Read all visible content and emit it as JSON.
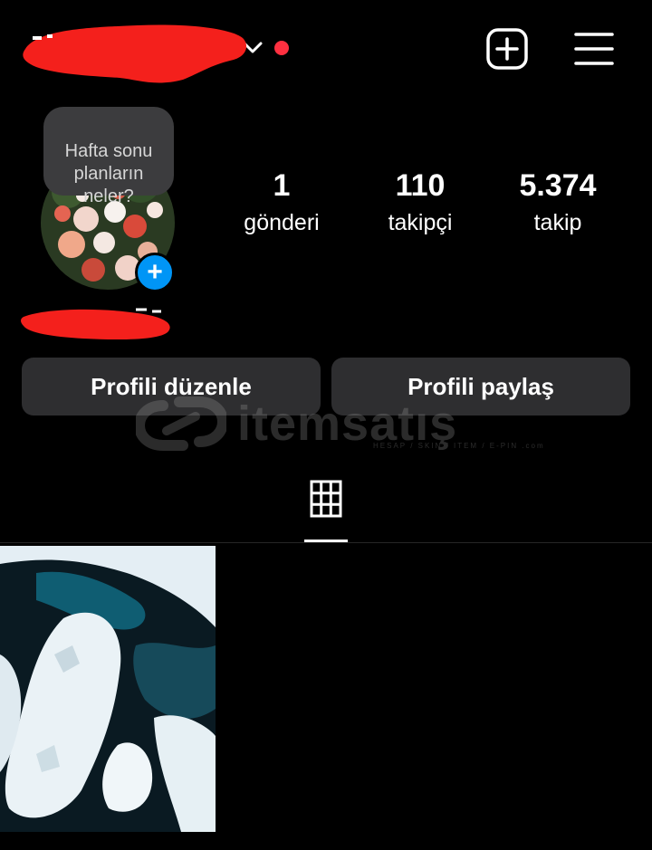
{
  "header": {
    "username_redacted": true,
    "has_notification_dot": true,
    "icons": [
      "chevron-down-icon",
      "add-post-icon",
      "menu-icon"
    ]
  },
  "note": {
    "text": "Hafta sonu\nplanların\nneler?"
  },
  "stats": [
    {
      "value": "1",
      "label": "gönderi"
    },
    {
      "value": "110",
      "label": "takipçi"
    },
    {
      "value": "5.374",
      "label": "takip"
    }
  ],
  "buttons": {
    "edit_profile": "Profili düzenle",
    "share_profile": "Profili paylaş"
  },
  "watermark": {
    "brand": "itemsatış",
    "sub": "HESAP / SKIN / ITEM / E-PIN .com"
  },
  "tabs": {
    "active": "grid-icon"
  },
  "posts": [
    {
      "alt": "ice"
    }
  ],
  "colors": {
    "background": "#000000",
    "button_bg": "#2e2e30",
    "accent_blue": "#0095f6",
    "notification_red": "#ff3040"
  }
}
